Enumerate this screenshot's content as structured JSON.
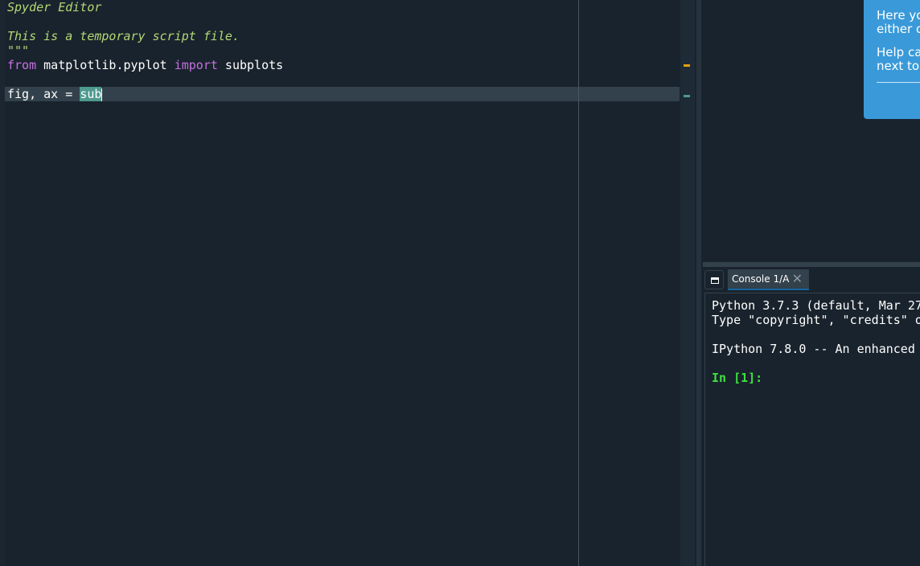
{
  "editor": {
    "lines": [
      "Spyder Editor",
      "This is a temporary script file.",
      "\"\"\"",
      "from",
      " matplotlib.pyplot ",
      "import",
      " subplots",
      "fig, ax = ",
      "sub"
    ]
  },
  "help_tip": {
    "line1": "Here yo",
    "line2": "either o",
    "line3": "Help car",
    "line4": "next to"
  },
  "console": {
    "tab_label": "Console 1/A",
    "close_glyph": "✕",
    "lines": [
      "Python 3.7.3 (default, Mar 27",
      "Type \"copyright\", \"credits\" o",
      "IPython 7.8.0 -- An enhanced",
      "In [1]:"
    ]
  },
  "colors": {
    "background": "#19232d",
    "keyword": "#c670e0",
    "comment": "#b4d875",
    "prompt": "#3fe03f",
    "tip": "#3a9ad9",
    "flag_warning": "#e6a00f",
    "flag_occurrence": "#4e9a8f"
  }
}
